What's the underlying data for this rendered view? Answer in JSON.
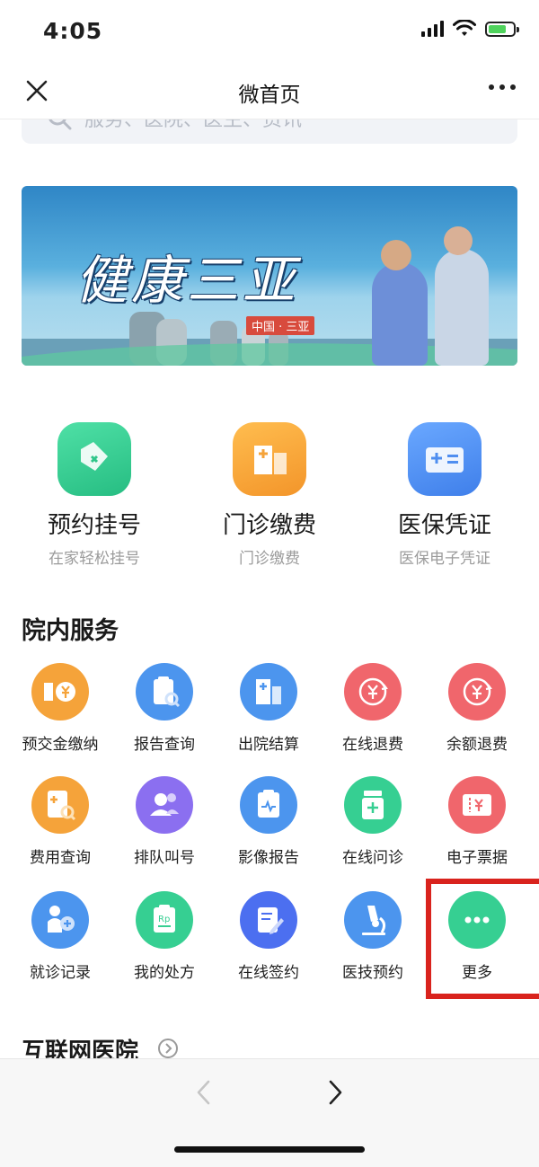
{
  "status_bar": {
    "time": "4:05"
  },
  "nav": {
    "title": "微首页"
  },
  "search": {
    "placeholder": "服务、医院、医生、资讯"
  },
  "banner": {
    "title": "健康三亚",
    "subtitle": "中国 · 三亚"
  },
  "main_services": [
    {
      "label": "预约挂号",
      "sub": "在家轻松挂号",
      "icon": "tag-icon",
      "color": "#36cf92"
    },
    {
      "label": "门诊缴费",
      "sub": "门诊缴费",
      "icon": "hospital-icon",
      "color": "#f7a43a"
    },
    {
      "label": "医保凭证",
      "sub": "医保电子凭证",
      "icon": "medical-card-icon",
      "color": "#4f8ef0"
    }
  ],
  "section_title": "院内服务",
  "grid_items": [
    {
      "label": "预交金缴纳",
      "icon": "prepay-icon",
      "color": "#f5a33a"
    },
    {
      "label": "报告查询",
      "icon": "report-search-icon",
      "color": "#4c95ee"
    },
    {
      "label": "出院结算",
      "icon": "hospital-building-icon",
      "color": "#4c95ee"
    },
    {
      "label": "在线退费",
      "icon": "refund-icon",
      "color": "#f0666c"
    },
    {
      "label": "余额退费",
      "icon": "balance-refund-icon",
      "color": "#f0666c"
    },
    {
      "label": "费用查询",
      "icon": "fee-search-icon",
      "color": "#f5a33a"
    },
    {
      "label": "排队叫号",
      "icon": "queue-icon",
      "color": "#8b6ff0"
    },
    {
      "label": "影像报告",
      "icon": "imaging-report-icon",
      "color": "#4c95ee"
    },
    {
      "label": "在线问诊",
      "icon": "medicine-bottle-icon",
      "color": "#36cf92"
    },
    {
      "label": "电子票据",
      "icon": "e-ticket-icon",
      "color": "#f0666c"
    },
    {
      "label": "就诊记录",
      "icon": "visit-record-icon",
      "color": "#4c95ee"
    },
    {
      "label": "我的处方",
      "icon": "prescription-icon",
      "color": "#36cf92"
    },
    {
      "label": "在线签约",
      "icon": "sign-icon",
      "color": "#4c6ff0"
    },
    {
      "label": "医技预约",
      "icon": "microscope-icon",
      "color": "#4c95ee"
    },
    {
      "label": "更多",
      "icon": "more-icon",
      "color": "#36cf92"
    }
  ],
  "internet_title": "互联网医院",
  "bottom_nav": {
    "back": "‹",
    "forward": "›"
  }
}
